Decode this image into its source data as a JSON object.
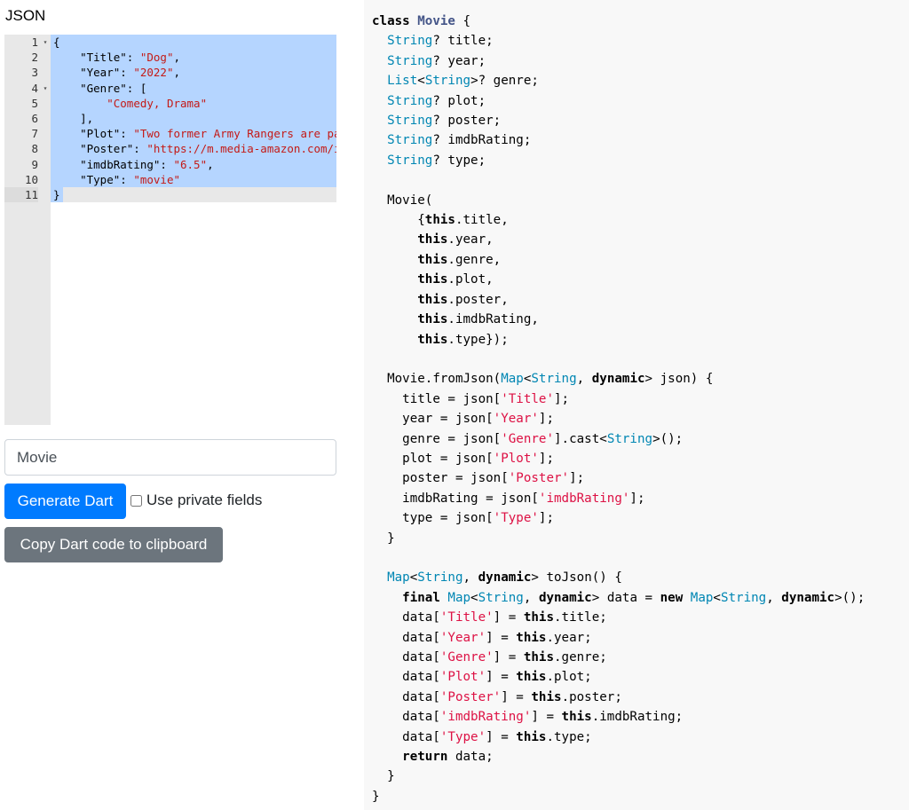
{
  "heading": "JSON",
  "editor": {
    "lines": [
      {
        "n": "1",
        "fold": true,
        "tokens": [
          [
            "p",
            "{"
          ]
        ]
      },
      {
        "n": "2",
        "fold": false,
        "tokens": [
          [
            "p",
            "    \"Title\": "
          ],
          [
            "s",
            "\"Dog\""
          ],
          [
            "p",
            ","
          ]
        ]
      },
      {
        "n": "3",
        "fold": false,
        "tokens": [
          [
            "p",
            "    \"Year\": "
          ],
          [
            "s",
            "\"2022\""
          ],
          [
            "p",
            ","
          ]
        ]
      },
      {
        "n": "4",
        "fold": true,
        "tokens": [
          [
            "p",
            "    \"Genre\": ["
          ]
        ]
      },
      {
        "n": "5",
        "fold": false,
        "tokens": [
          [
            "p",
            "        "
          ],
          [
            "s",
            "\"Comedy, Drama\""
          ]
        ]
      },
      {
        "n": "6",
        "fold": false,
        "tokens": [
          [
            "p",
            "    ],"
          ]
        ]
      },
      {
        "n": "7",
        "fold": false,
        "tokens": [
          [
            "p",
            "    \"Plot\": "
          ],
          [
            "s",
            "\"Two former Army Rangers are paired together\""
          ]
        ]
      },
      {
        "n": "8",
        "fold": false,
        "tokens": [
          [
            "p",
            "    \"Poster\": "
          ],
          [
            "s",
            "\"https://m.media-amazon.com/images\""
          ]
        ]
      },
      {
        "n": "9",
        "fold": false,
        "tokens": [
          [
            "p",
            "    \"imdbRating\": "
          ],
          [
            "s",
            "\"6.5\""
          ],
          [
            "p",
            ","
          ]
        ]
      },
      {
        "n": "10",
        "fold": false,
        "tokens": [
          [
            "p",
            "    \"Type\": "
          ],
          [
            "s",
            "\"movie\""
          ]
        ]
      },
      {
        "n": "11",
        "fold": false,
        "tokens": [
          [
            "p",
            "}"
          ]
        ]
      }
    ]
  },
  "form": {
    "class_name_value": "Movie",
    "generate_label": "Generate Dart",
    "private_fields_label": "Use private fields",
    "private_fields_checked": false,
    "copy_label": "Copy Dart code to clipboard"
  },
  "output": {
    "lines": [
      [
        [
          "kw",
          "class "
        ],
        [
          "cls",
          "Movie"
        ],
        [
          "p",
          " {"
        ]
      ],
      [
        [
          "p",
          "  "
        ],
        [
          "ty",
          "String"
        ],
        [
          "p",
          "? title;"
        ]
      ],
      [
        [
          "p",
          "  "
        ],
        [
          "ty",
          "String"
        ],
        [
          "p",
          "? year;"
        ]
      ],
      [
        [
          "p",
          "  "
        ],
        [
          "ty",
          "List"
        ],
        [
          "p",
          "<"
        ],
        [
          "ty",
          "String"
        ],
        [
          "p",
          ">? genre;"
        ]
      ],
      [
        [
          "p",
          "  "
        ],
        [
          "ty",
          "String"
        ],
        [
          "p",
          "? plot;"
        ]
      ],
      [
        [
          "p",
          "  "
        ],
        [
          "ty",
          "String"
        ],
        [
          "p",
          "? poster;"
        ]
      ],
      [
        [
          "p",
          "  "
        ],
        [
          "ty",
          "String"
        ],
        [
          "p",
          "? imdbRating;"
        ]
      ],
      [
        [
          "p",
          "  "
        ],
        [
          "ty",
          "String"
        ],
        [
          "p",
          "? type;"
        ]
      ],
      [
        [
          "p",
          ""
        ]
      ],
      [
        [
          "p",
          "  Movie("
        ]
      ],
      [
        [
          "p",
          "      {"
        ],
        [
          "kw",
          "this"
        ],
        [
          "p",
          ".title,"
        ]
      ],
      [
        [
          "p",
          "      "
        ],
        [
          "kw",
          "this"
        ],
        [
          "p",
          ".year,"
        ]
      ],
      [
        [
          "p",
          "      "
        ],
        [
          "kw",
          "this"
        ],
        [
          "p",
          ".genre,"
        ]
      ],
      [
        [
          "p",
          "      "
        ],
        [
          "kw",
          "this"
        ],
        [
          "p",
          ".plot,"
        ]
      ],
      [
        [
          "p",
          "      "
        ],
        [
          "kw",
          "this"
        ],
        [
          "p",
          ".poster,"
        ]
      ],
      [
        [
          "p",
          "      "
        ],
        [
          "kw",
          "this"
        ],
        [
          "p",
          ".imdbRating,"
        ]
      ],
      [
        [
          "p",
          "      "
        ],
        [
          "kw",
          "this"
        ],
        [
          "p",
          ".type});"
        ]
      ],
      [
        [
          "p",
          ""
        ]
      ],
      [
        [
          "p",
          "  Movie.fromJson("
        ],
        [
          "ty",
          "Map"
        ],
        [
          "p",
          "<"
        ],
        [
          "ty",
          "String"
        ],
        [
          "p",
          ", "
        ],
        [
          "kw",
          "dynamic"
        ],
        [
          "p",
          "> json) {"
        ]
      ],
      [
        [
          "p",
          "    title = json["
        ],
        [
          "str",
          "'Title'"
        ],
        [
          "p",
          "];"
        ]
      ],
      [
        [
          "p",
          "    year = json["
        ],
        [
          "str",
          "'Year'"
        ],
        [
          "p",
          "];"
        ]
      ],
      [
        [
          "p",
          "    genre = json["
        ],
        [
          "str",
          "'Genre'"
        ],
        [
          "p",
          "].cast<"
        ],
        [
          "ty",
          "String"
        ],
        [
          "p",
          ">();"
        ]
      ],
      [
        [
          "p",
          "    plot = json["
        ],
        [
          "str",
          "'Plot'"
        ],
        [
          "p",
          "];"
        ]
      ],
      [
        [
          "p",
          "    poster = json["
        ],
        [
          "str",
          "'Poster'"
        ],
        [
          "p",
          "];"
        ]
      ],
      [
        [
          "p",
          "    imdbRating = json["
        ],
        [
          "str",
          "'imdbRating'"
        ],
        [
          "p",
          "];"
        ]
      ],
      [
        [
          "p",
          "    type = json["
        ],
        [
          "str",
          "'Type'"
        ],
        [
          "p",
          "];"
        ]
      ],
      [
        [
          "p",
          "  }"
        ]
      ],
      [
        [
          "p",
          ""
        ]
      ],
      [
        [
          "p",
          "  "
        ],
        [
          "ty",
          "Map"
        ],
        [
          "p",
          "<"
        ],
        [
          "ty",
          "String"
        ],
        [
          "p",
          ", "
        ],
        [
          "kw",
          "dynamic"
        ],
        [
          "p",
          "> toJson() {"
        ]
      ],
      [
        [
          "p",
          "    "
        ],
        [
          "kw",
          "final "
        ],
        [
          "ty",
          "Map"
        ],
        [
          "p",
          "<"
        ],
        [
          "ty",
          "String"
        ],
        [
          "p",
          ", "
        ],
        [
          "kw",
          "dynamic"
        ],
        [
          "p",
          "> data = "
        ],
        [
          "kw",
          "new "
        ],
        [
          "ty",
          "Map"
        ],
        [
          "p",
          "<"
        ],
        [
          "ty",
          "String"
        ],
        [
          "p",
          ", "
        ],
        [
          "kw",
          "dynamic"
        ],
        [
          "p",
          ">();"
        ]
      ],
      [
        [
          "p",
          "    data["
        ],
        [
          "str",
          "'Title'"
        ],
        [
          "p",
          "] = "
        ],
        [
          "kw",
          "this"
        ],
        [
          "p",
          ".title;"
        ]
      ],
      [
        [
          "p",
          "    data["
        ],
        [
          "str",
          "'Year'"
        ],
        [
          "p",
          "] = "
        ],
        [
          "kw",
          "this"
        ],
        [
          "p",
          ".year;"
        ]
      ],
      [
        [
          "p",
          "    data["
        ],
        [
          "str",
          "'Genre'"
        ],
        [
          "p",
          "] = "
        ],
        [
          "kw",
          "this"
        ],
        [
          "p",
          ".genre;"
        ]
      ],
      [
        [
          "p",
          "    data["
        ],
        [
          "str",
          "'Plot'"
        ],
        [
          "p",
          "] = "
        ],
        [
          "kw",
          "this"
        ],
        [
          "p",
          ".plot;"
        ]
      ],
      [
        [
          "p",
          "    data["
        ],
        [
          "str",
          "'Poster'"
        ],
        [
          "p",
          "] = "
        ],
        [
          "kw",
          "this"
        ],
        [
          "p",
          ".poster;"
        ]
      ],
      [
        [
          "p",
          "    data["
        ],
        [
          "str",
          "'imdbRating'"
        ],
        [
          "p",
          "] = "
        ],
        [
          "kw",
          "this"
        ],
        [
          "p",
          ".imdbRating;"
        ]
      ],
      [
        [
          "p",
          "    data["
        ],
        [
          "str",
          "'Type'"
        ],
        [
          "p",
          "] = "
        ],
        [
          "kw",
          "this"
        ],
        [
          "p",
          ".type;"
        ]
      ],
      [
        [
          "p",
          "    "
        ],
        [
          "kw",
          "return"
        ],
        [
          "p",
          " data;"
        ]
      ],
      [
        [
          "p",
          "  }"
        ]
      ],
      [
        [
          "p",
          "}"
        ]
      ]
    ]
  }
}
